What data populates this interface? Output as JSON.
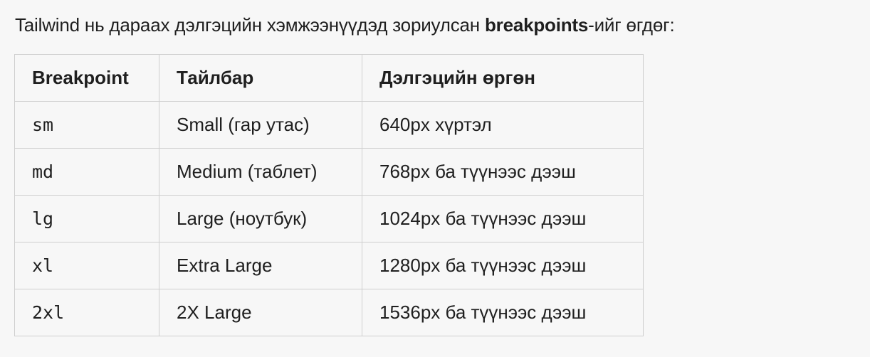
{
  "intro": {
    "before": "Tailwind нь дараах дэлгэцийн хэмжээнүүдэд зориулсан ",
    "strong": "breakpoints",
    "after": "-ийг өгдөг:"
  },
  "table": {
    "headers": [
      "Breakpoint",
      "Тайлбар",
      "Дэлгэцийн өргөн"
    ],
    "rows": [
      [
        "sm",
        "Small (гар утас)",
        "640px хүртэл"
      ],
      [
        "md",
        "Medium (таблет)",
        "768px ба түүнээс дээш"
      ],
      [
        "lg",
        "Large (ноутбук)",
        "1024px ба түүнээс дээш"
      ],
      [
        "xl",
        "Extra Large",
        "1280px ба түүнээс дээш"
      ],
      [
        "2xl",
        "2X Large",
        "1536px ба түүнээс дээш"
      ]
    ]
  }
}
